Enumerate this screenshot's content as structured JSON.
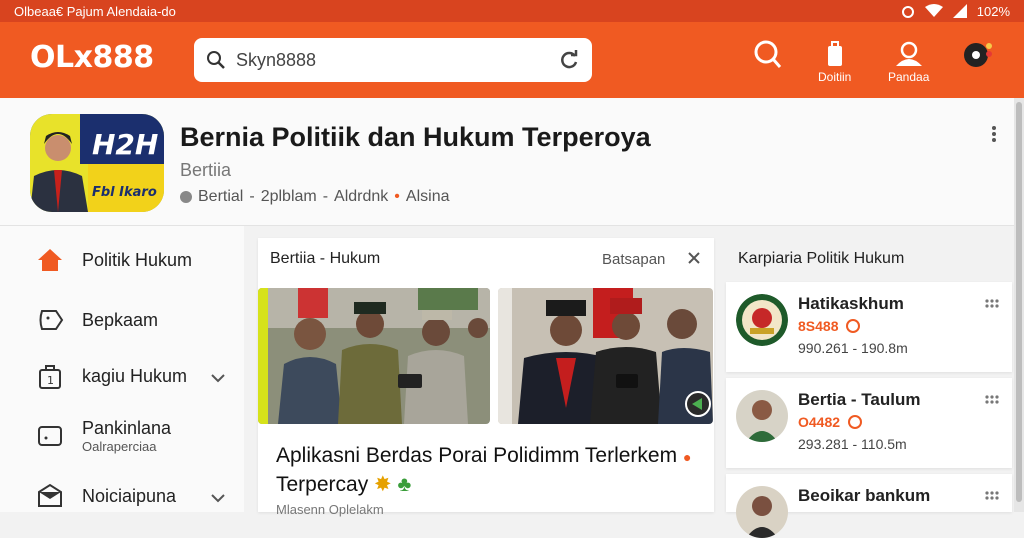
{
  "statusbar": {
    "left_text": "Olbeaa€ Pajum Alendaia-do",
    "battery": "102%"
  },
  "header": {
    "logo": "OLx888",
    "search_value": "Skyn8888",
    "buttons": [
      {
        "label": "",
        "icon": "search-icon"
      },
      {
        "label": "Doitiin",
        "icon": "bag-icon"
      },
      {
        "label": "Pandaa",
        "icon": "user-icon"
      },
      {
        "label": "",
        "icon": "chat-icon"
      }
    ]
  },
  "profile": {
    "title": "Bernia Politiik dan Hukum Terperoya",
    "subtitle": "Bertiia",
    "meta_1": "Bertial",
    "meta_2": "2plblam",
    "meta_3": "Aldrdnk",
    "meta_4": "Alsina",
    "avatar_text_1": "H2H",
    "avatar_text_2": "Fbl Ikaro"
  },
  "sidebar": {
    "items": [
      {
        "label": "Politik Hukum",
        "icon": "home-icon"
      },
      {
        "label": "Bepkaam",
        "icon": "tag-icon"
      },
      {
        "label": "kagiu Hukum",
        "icon": "bag-icon"
      },
      {
        "label": "Pankinlana",
        "sub": "Oalraperciaa",
        "icon": "note-icon"
      },
      {
        "label": "Noiciaipuna",
        "icon": "mail-icon"
      }
    ]
  },
  "card": {
    "head": "Bertiia - Hukum",
    "action": "Batsapan",
    "headline_1": "Aplikasni Berdas Porai Polidimm Terlerkem",
    "headline_2": "Terpercay",
    "byline": "Mlasenn Oplelakm"
  },
  "rpanel": {
    "title": "Karpiaria Politik Hukum",
    "items": [
      {
        "name": "Hatikaskhum",
        "code": "8S488",
        "num": "990.261 - 190.8m"
      },
      {
        "name": "Bertia - Taulum",
        "code": "O4482",
        "num": "293.281 - 110.5m"
      },
      {
        "name": "Beoikar bankum",
        "code": "",
        "num": ""
      }
    ]
  },
  "colors": {
    "accent": "#f05a22",
    "statusbar": "#d8441f"
  }
}
